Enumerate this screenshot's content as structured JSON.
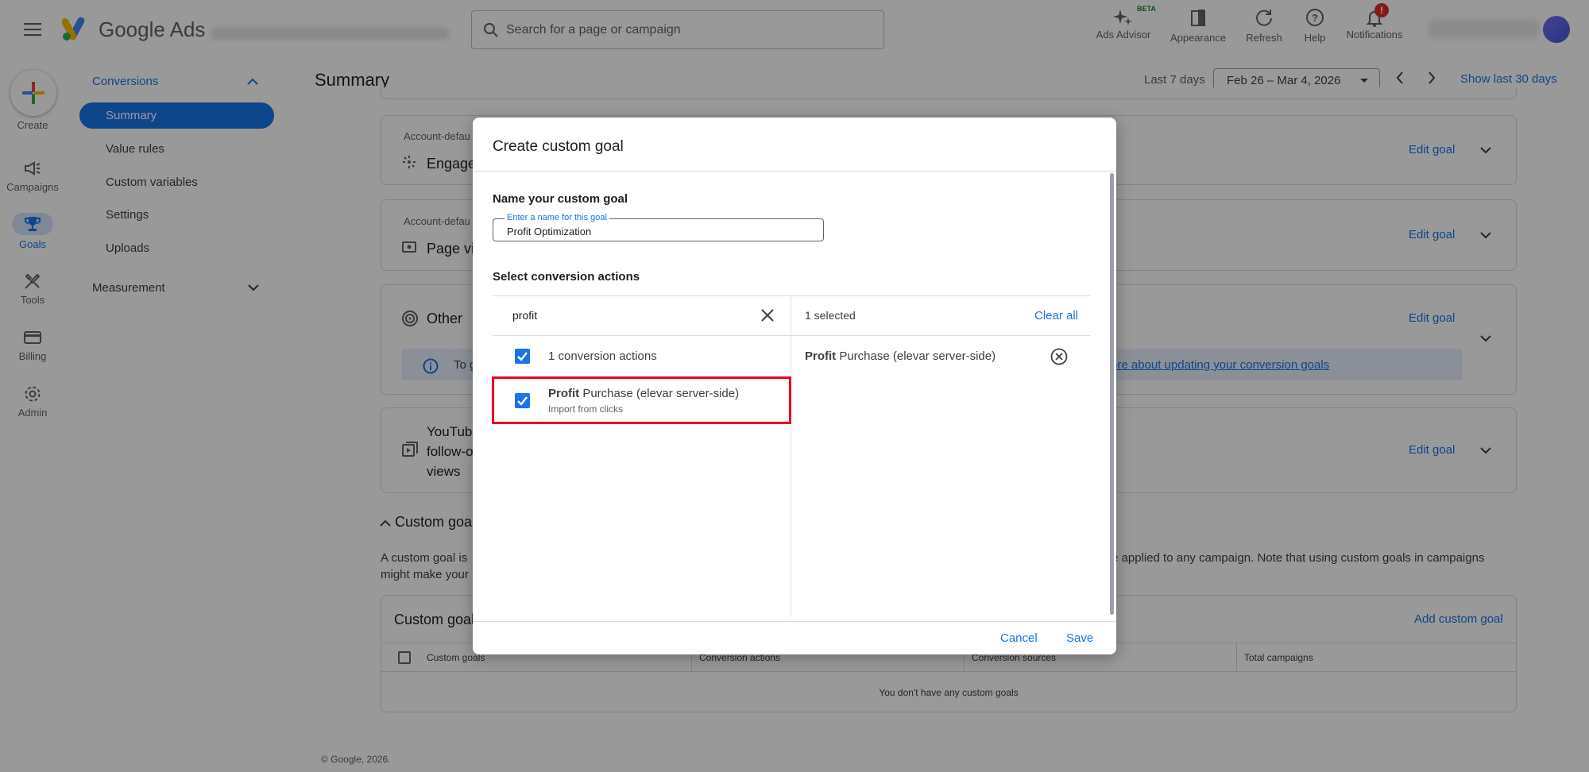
{
  "app": {
    "name": "Google Ads",
    "search_placeholder": "Search for a page or campaign"
  },
  "toolbar": [
    {
      "label": "Ads Advisor",
      "badge": "BETA",
      "icon": "sparkle-icon"
    },
    {
      "label": "Appearance",
      "icon": "appearance-icon"
    },
    {
      "label": "Refresh",
      "icon": "refresh-icon"
    },
    {
      "label": "Help",
      "icon": "help-icon"
    },
    {
      "label": "Notifications",
      "icon": "bell-icon",
      "badge": "!"
    }
  ],
  "rail": [
    {
      "label": "Create",
      "icon": "plus-icon"
    },
    {
      "label": "Campaigns",
      "icon": "megaphone-icon"
    },
    {
      "label": "Goals",
      "icon": "trophy-icon"
    },
    {
      "label": "Tools",
      "icon": "tools-icon"
    },
    {
      "label": "Billing",
      "icon": "card-icon"
    },
    {
      "label": "Admin",
      "icon": "gear-icon"
    }
  ],
  "sidebar": {
    "section": "Conversions",
    "items": [
      "Summary",
      "Value rules",
      "Custom variables",
      "Settings",
      "Uploads"
    ],
    "measurement": "Measurement"
  },
  "page": {
    "title": "Summary",
    "date_prefix": "Last 7 days",
    "date_range": "Feb 26 – Mar 4, 2026",
    "show_last": "Show last 30 days"
  },
  "background_cards": {
    "account_default": "Account-defau",
    "engage": "Engage",
    "page_views": "Page vi",
    "other": "Other",
    "info_text": "To g",
    "info_link": "ore about updating your conversion goals",
    "youtube": [
      "YouTub",
      "follow-o",
      "views"
    ],
    "edit_goal": "Edit goal",
    "custom_goals_header": "Custom goal",
    "custom_desc_1": "A custom goal is",
    "custom_desc_1b": "e applied to any campaign. Note that using custom goals in campaigns",
    "custom_desc_2": "might make your",
    "table_title": "Custom goal",
    "add_custom_goal": "Add custom goal",
    "columns": [
      "Custom goals",
      "Conversion actions",
      "Conversion sources",
      "Total campaigns"
    ],
    "empty": "You don't have any custom goals",
    "footer": "© Google, 2026."
  },
  "dialog": {
    "title": "Create custom goal",
    "name_section": "Name your custom goal",
    "name_label": "Enter a name for this goal",
    "name_value": "Profit Optimization",
    "select_section": "Select conversion actions",
    "search_value": "profit",
    "select_all_label": "1 conversion actions",
    "action_bold": "Profit",
    "action_rest": " Purchase (elevar server-side)",
    "action_sub": "Import from clicks",
    "selected_count": "1 selected",
    "clear_all": "Clear all",
    "cancel": "Cancel",
    "save": "Save"
  },
  "colors": {
    "accent": "#1a73e8",
    "highlight": "#e8001c"
  }
}
